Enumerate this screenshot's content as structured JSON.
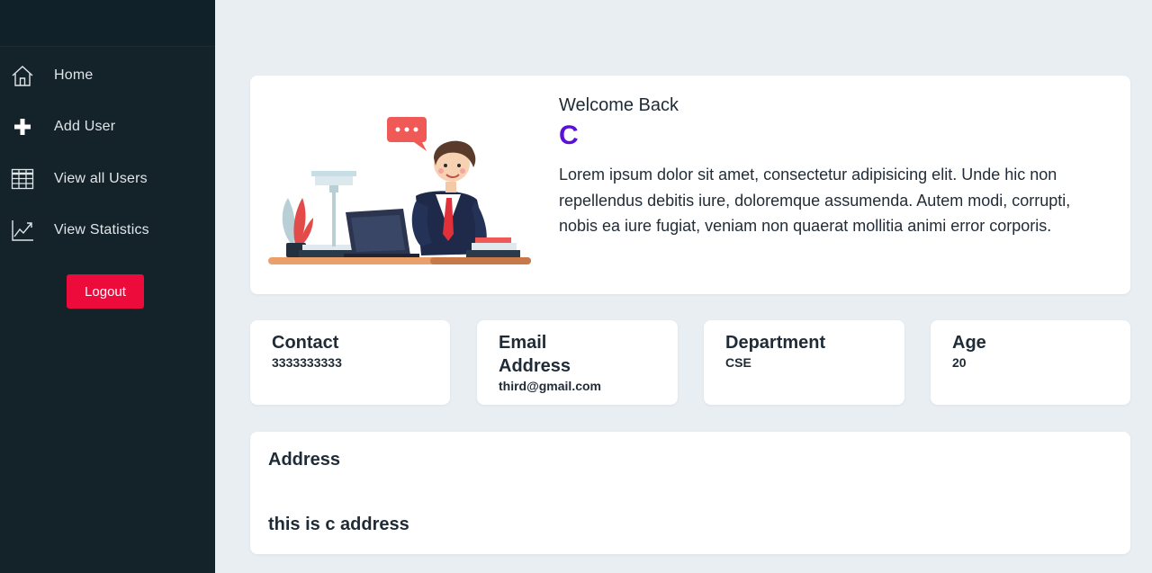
{
  "sidebar": {
    "items": [
      {
        "label": "Home",
        "icon": "home-icon"
      },
      {
        "label": "Add User",
        "icon": "plus-icon"
      },
      {
        "label": "View all Users",
        "icon": "table-icon"
      },
      {
        "label": "View Statistics",
        "icon": "chart-line-icon"
      }
    ],
    "logout_label": "Logout"
  },
  "welcome": {
    "title": "Welcome Back",
    "name": "C",
    "text": "Lorem ipsum dolor sit amet, consectetur adipisicing elit. Unde hic non repellendus debitis iure, doloremque assumenda. Autem modi, corrupti, nobis ea iure fugiat, veniam non quaerat mollitia animi error corporis."
  },
  "info_cards": [
    {
      "title": "Contact",
      "value": "3333333333"
    },
    {
      "title": "Email Address",
      "value": "third@gmail.com"
    },
    {
      "title": "Department",
      "value": "CSE"
    },
    {
      "title": "Age",
      "value": "20"
    }
  ],
  "address": {
    "title": "Address",
    "value": "this is c address"
  },
  "colors": {
    "sidebar_bg": "#14222a",
    "page_bg": "#e9eef3",
    "logout_button": "#ec0b3b",
    "name_accent": "#5a10d8"
  }
}
